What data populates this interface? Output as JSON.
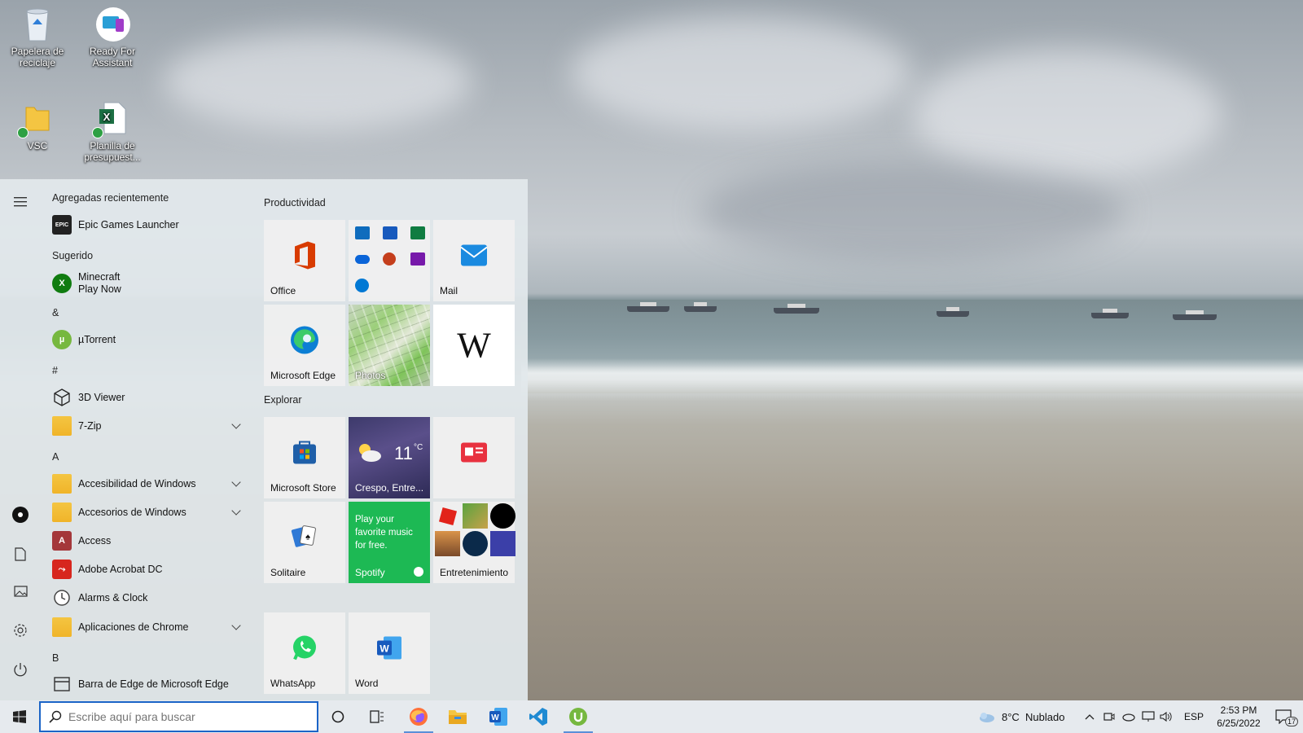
{
  "desktop": {
    "icons": [
      {
        "label": "Papelera de reciclaje",
        "icon": "recycle-bin-icon"
      },
      {
        "label": "Ready For Assistant",
        "icon": "ready-for-assistant-icon"
      },
      {
        "label": "VSC",
        "icon": "folder-icon"
      },
      {
        "label": "Planilla de presupuest...",
        "icon": "excel-file-icon"
      }
    ]
  },
  "start_menu": {
    "recent_header": "Agregadas recientemente",
    "suggested_header": "Sugerido",
    "apps": [
      {
        "label": "Epic Games Launcher",
        "icon": "epic-games-icon"
      },
      {
        "label": "Minecraft",
        "sub": "Play Now",
        "icon": "xbox-icon"
      },
      {
        "letter": "&"
      },
      {
        "label": "µTorrent",
        "icon": "utorrent-icon"
      },
      {
        "letter": "#"
      },
      {
        "label": "3D Viewer",
        "icon": "3d-viewer-icon"
      },
      {
        "label": "7-Zip",
        "icon": "folder-icon",
        "expandable": true
      },
      {
        "letter": "A"
      },
      {
        "label": "Accesibilidad de Windows",
        "icon": "folder-icon",
        "expandable": true
      },
      {
        "label": "Accesorios de Windows",
        "icon": "folder-icon",
        "expandable": true
      },
      {
        "label": "Access",
        "icon": "access-icon"
      },
      {
        "label": "Adobe Acrobat DC",
        "icon": "acrobat-icon"
      },
      {
        "label": "Alarms & Clock",
        "icon": "clock-icon"
      },
      {
        "label": "Aplicaciones de Chrome",
        "icon": "folder-icon",
        "expandable": true
      },
      {
        "letter": "B"
      },
      {
        "label": "Barra de Edge de Microsoft Edge",
        "icon": "edge-bar-icon"
      }
    ],
    "groups": {
      "productividad": "Productividad",
      "explorar": "Explorar"
    },
    "tiles": {
      "office": "Office",
      "mail": "Mail",
      "edge": "Microsoft Edge",
      "photos": "Photos",
      "wikipedia_letter": "W",
      "store": "Microsoft Store",
      "weather_temp": "11",
      "weather_unit": "°C",
      "weather_place": "Crespo, Entre...",
      "solitaire": "Solitaire",
      "spotify_promo": "Play your favorite music for free.",
      "spotify": "Spotify",
      "entretenimiento": "Entretenimiento",
      "whatsapp": "WhatsApp",
      "word": "Word"
    }
  },
  "taskbar": {
    "search_placeholder": "Escribe aquí para buscar",
    "weather": "8°C  Nublado",
    "language": "ESP",
    "time": "2:53 PM",
    "date": "6/25/2022",
    "notification_count": "17",
    "pinned": [
      "cortana-icon",
      "task-view-icon",
      "firefox-icon",
      "file-explorer-icon",
      "word-icon",
      "vscode-icon",
      "utorrent-icon"
    ]
  },
  "colors": {
    "accent": "#1b64c7",
    "spotify": "#1db954",
    "office": "#d83b01"
  }
}
